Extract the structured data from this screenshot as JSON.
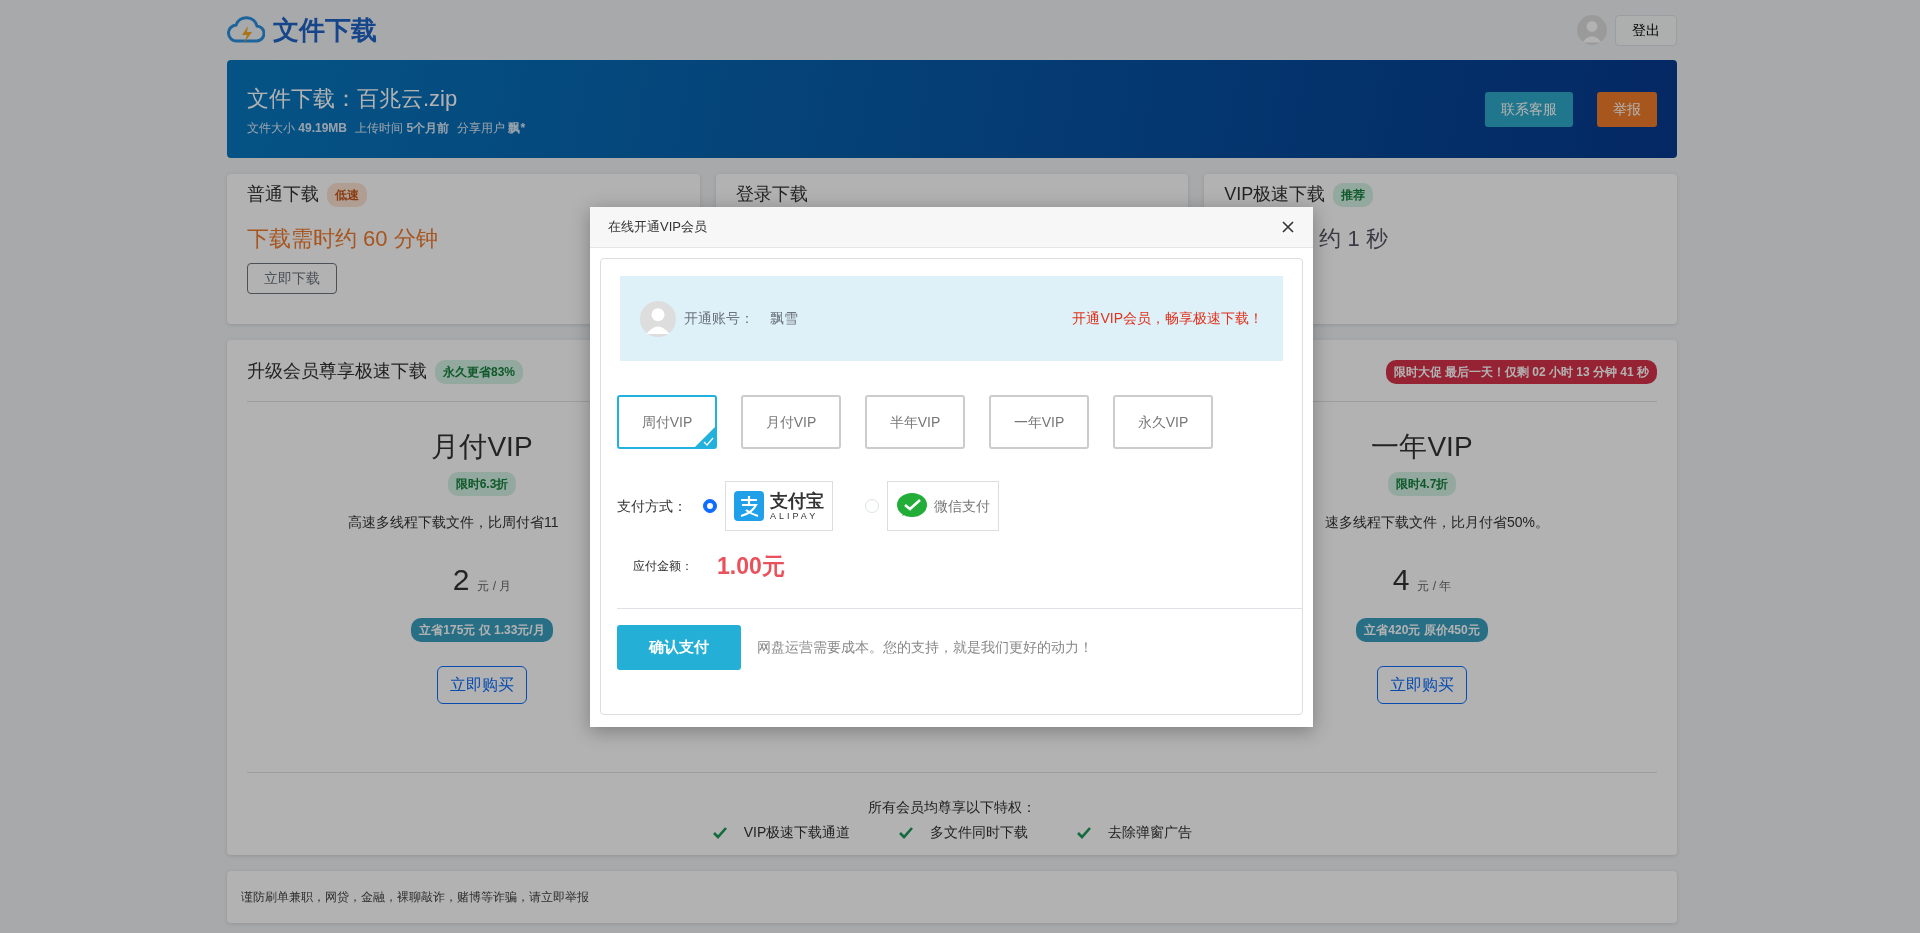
{
  "brand": {
    "title": "文件下载"
  },
  "user": {
    "logout": "登出"
  },
  "file": {
    "title": "文件下载：百兆云.zip",
    "meta": [
      {
        "label": "文件大小",
        "value": "49.19MB"
      },
      {
        "label": "上传时间",
        "value": "5个月前"
      },
      {
        "label": "分享用户",
        "value": "飘*"
      }
    ],
    "actions": [
      {
        "label": "联系客服",
        "kind": "info"
      },
      {
        "label": "举报",
        "kind": "warning"
      }
    ]
  },
  "download_options": [
    {
      "kind": "normal",
      "title": "普通下载",
      "badge": "低速",
      "time": "下载需时约 60 分钟",
      "button": "立即下载"
    },
    {
      "kind": "login",
      "title": "登录下载"
    },
    {
      "kind": "vip",
      "title": "VIP极速下载",
      "badge": "推荐",
      "time": "约 1 秒"
    }
  ],
  "upgrade": {
    "title": "升级会员尊享极速下载",
    "badge": "永久更省83%",
    "countdown": "限时大促 最后一天！仅剩 02 小时 13 分钟 41 秒",
    "plans": [
      {
        "name": "月付VIP",
        "discount": "限时6.3折",
        "desc": "高速多线程下载文件，比周付省11",
        "price": "2",
        "unit": "元 / 月",
        "saving": "立省175元 仅 1.33元/月",
        "button": "立即购买"
      },
      {
        "name": "一年VIP",
        "discount": "限时4.7折",
        "desc": "速多线程下载文件，比月付省50%。",
        "price": "4",
        "unit": "元 / 年",
        "saving": "立省420元 原价450元",
        "button": "立即购买"
      }
    ],
    "perks_title": "所有会员均尊享以下特权：",
    "perks": [
      "VIP极速下载通道",
      "多文件同时下载",
      "去除弹窗广告"
    ]
  },
  "notice": "谨防刷单兼职，网贷，金融，裸聊敲诈，赌博等诈骗，请立即举报",
  "modal": {
    "title": "在线开通VIP会员",
    "account_label": "开通账号：",
    "account": "飘雪",
    "slogan": "开通VIP会员，畅享极速下载！",
    "plans": [
      {
        "label": "周付VIP",
        "selected": true
      },
      {
        "label": "月付VIP",
        "selected": false
      },
      {
        "label": "半年VIP",
        "selected": false
      },
      {
        "label": "一年VIP",
        "selected": false
      },
      {
        "label": "永久VIP",
        "selected": false
      }
    ],
    "payment_label": "支付方式：",
    "payment_methods": [
      {
        "kind": "alipay",
        "name": "支付宝",
        "subtitle": "ALIPAY",
        "selected": true
      },
      {
        "kind": "wechat",
        "name": "微信支付",
        "selected": false
      }
    ],
    "amount_label": "应付金额：",
    "amount": "1.00元",
    "confirm": "确认支付",
    "note": "网盘运营需要成本。您的支持，就是我们更好的动力！"
  }
}
